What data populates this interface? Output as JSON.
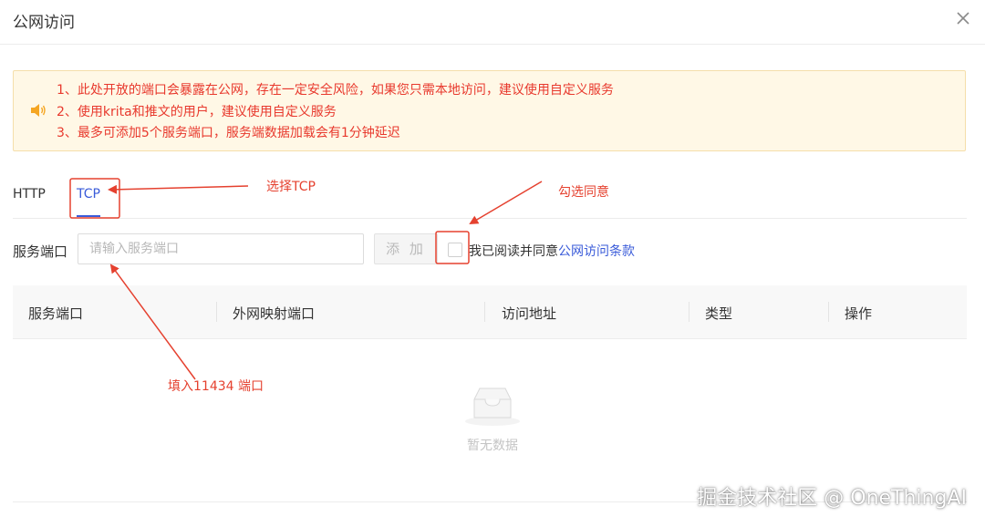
{
  "dialog": {
    "title": "公网访问",
    "close_icon": "close-icon"
  },
  "notice": {
    "icon": "speaker-icon",
    "lines": [
      "1、此处开放的端口会暴露在公网，存在一定安全风险，如果您只需本地访问，建议使用自定义服务",
      "2、使用krita和推文的用户，建议使用自定义服务",
      "3、最多可添加5个服务端口，服务端数据加载会有1分钟延迟"
    ]
  },
  "tabs": [
    {
      "label": "HTTP",
      "active": false
    },
    {
      "label": "TCP",
      "active": true
    }
  ],
  "port_form": {
    "label": "服务端口",
    "placeholder": "请输入服务端口",
    "value": "",
    "add_label": "添 加",
    "agree_checked": false,
    "agree_text": "我已阅读并同意",
    "agree_link": "公网访问条款"
  },
  "table": {
    "columns": [
      "服务端口",
      "外网映射端口",
      "访问地址",
      "类型",
      "操作"
    ],
    "rows": [],
    "empty_text": "暂无数据"
  },
  "annotations": {
    "select_tcp": "选择TCP",
    "check_agree": "勾选同意",
    "fill_port": "填入11434 端口"
  },
  "watermark": "掘金技术社区 @ OneThingAI",
  "colors": {
    "accent": "#3a5bd9",
    "notice_text": "#e8392d",
    "notice_bg": "#fff8e6",
    "annotation": "#e5412f"
  }
}
